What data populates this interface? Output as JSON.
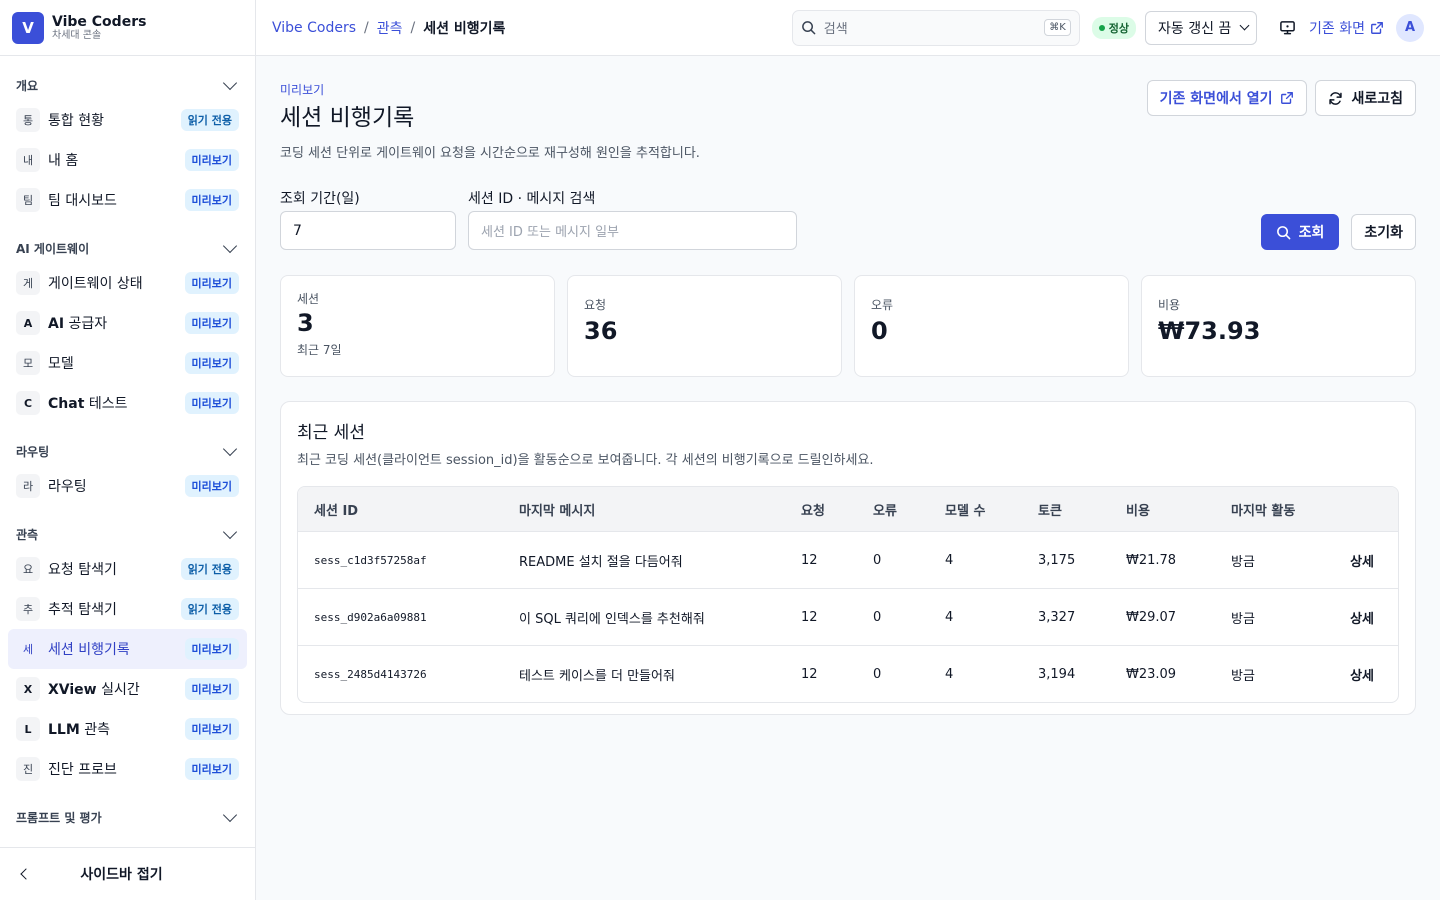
{
  "brand": {
    "logo": "V",
    "name": "Vibe Coders",
    "subtitle": "차세대 콘솔"
  },
  "sidebar": {
    "groups": [
      {
        "title": "개요",
        "items": [
          {
            "icon": "통",
            "label": "통합 현황",
            "badge": "읽기 전용"
          },
          {
            "icon": "내",
            "label": "내 홈",
            "badge": "미리보기"
          },
          {
            "icon": "팀",
            "label": "팀 대시보드",
            "badge": "미리보기"
          }
        ]
      },
      {
        "title": "AI 게이트웨이",
        "items": [
          {
            "icon": "게",
            "label": "게이트웨이 상태",
            "badge": "미리보기"
          },
          {
            "icon": "A",
            "label_bold": "AI",
            "label": " 공급자",
            "badge": "미리보기"
          },
          {
            "icon": "모",
            "label": "모델",
            "badge": "미리보기"
          },
          {
            "icon": "C",
            "label_bold": "Chat",
            "label": " 테스트",
            "badge": "미리보기"
          }
        ]
      },
      {
        "title": "라우팅",
        "items": [
          {
            "icon": "라",
            "label": "라우팅",
            "badge": "미리보기"
          }
        ]
      },
      {
        "title": "관측",
        "items": [
          {
            "icon": "요",
            "label": "요청 탐색기",
            "badge": "읽기 전용"
          },
          {
            "icon": "추",
            "label": "추적 탐색기",
            "badge": "읽기 전용"
          },
          {
            "icon": "세",
            "label": "세션 비행기록",
            "badge": "미리보기",
            "active": true
          },
          {
            "icon": "X",
            "label_bold": "XView",
            "label": " 실시간",
            "badge": "미리보기"
          },
          {
            "icon": "L",
            "label_bold": "LLM",
            "label": " 관측",
            "badge": "미리보기"
          },
          {
            "icon": "진",
            "label": "진단 프로브",
            "badge": "미리보기"
          }
        ]
      },
      {
        "title": "프롬프트 및 평가",
        "items": []
      }
    ],
    "collapse_label": "사이드바 접기"
  },
  "topbar": {
    "breadcrumb": [
      "Vibe Coders",
      "관측",
      "세션 비행기록"
    ],
    "search_placeholder": "검색",
    "search_shortcut": "⌘K",
    "status": "정상",
    "auto_refresh": "자동 갱신 끔",
    "legacy_link": "기존 화면",
    "avatar": "A"
  },
  "page": {
    "eyebrow": "미리보기",
    "title": "세션 비행기록",
    "description": "코딩 세션 단위로 게이트웨이 요청을 시간순으로 재구성해 원인을 추적합니다.",
    "open_legacy": "기존 화면에서 열기",
    "refresh": "새로고침"
  },
  "filters": {
    "period_label": "조회 기간(일)",
    "period_value": "7",
    "search_label": "세션 ID · 메시지 검색",
    "search_placeholder": "세션 ID 또는 메시지 일부",
    "submit": "조회",
    "reset": "초기화"
  },
  "kpis": [
    {
      "label": "세션",
      "value": "3",
      "sub": "최근 7일"
    },
    {
      "label": "요청",
      "value": "36"
    },
    {
      "label": "오류",
      "value": "0"
    },
    {
      "label": "비용",
      "value": "₩73.93"
    }
  ],
  "recent": {
    "title": "최근 세션",
    "description": "최근 코딩 세션(클라이언트 session_id)을 활동순으로 보여줍니다. 각 세션의 비행기록으로 드릴인하세요.",
    "columns": [
      "세션 ID",
      "마지막 메시지",
      "요청",
      "오류",
      "모델 수",
      "토큰",
      "비용",
      "마지막 활동",
      ""
    ],
    "rows": [
      {
        "id": "sess_c1d3f57258af",
        "message": "README 설치 절을 다듬어줘",
        "requests": "12",
        "errors": "0",
        "models": "4",
        "tokens": "3,175",
        "cost": "₩21.78",
        "last": "방금",
        "action": "상세"
      },
      {
        "id": "sess_d902a6a09881",
        "message": "이 SQL 쿼리에 인덱스를 추천해줘",
        "requests": "12",
        "errors": "0",
        "models": "4",
        "tokens": "3,327",
        "cost": "₩29.07",
        "last": "방금",
        "action": "상세"
      },
      {
        "id": "sess_2485d4143726",
        "message": "테스트 케이스를 더 만들어줘",
        "requests": "12",
        "errors": "0",
        "models": "4",
        "tokens": "3,194",
        "cost": "₩23.09",
        "last": "방금",
        "action": "상세"
      }
    ]
  },
  "colors": {
    "accent": "#3b4fd8",
    "active_bg": "#eef0fd",
    "ok": "#16a34a"
  }
}
